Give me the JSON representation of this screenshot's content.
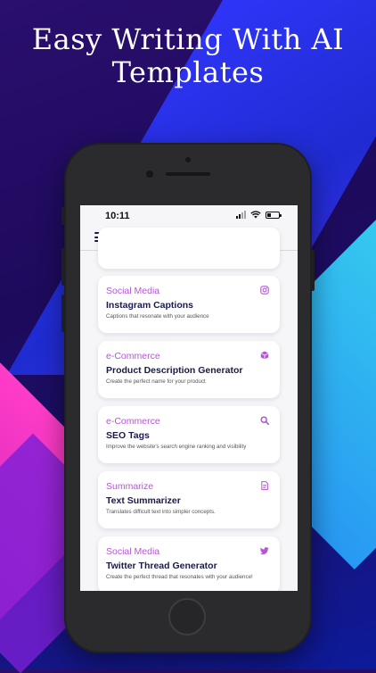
{
  "headline": {
    "line1": "Easy Writing With AI",
    "line2": "Templates"
  },
  "status_bar": {
    "time": "10:11",
    "battery_level": 0.35
  },
  "colors": {
    "category": "#b455d6",
    "title": "#1a1a4a"
  },
  "cards": [
    {
      "category": "Social Media",
      "title": "Instagram Captions",
      "description": "Captions that resonate with your audience",
      "icon": "instagram-icon"
    },
    {
      "category": "e-Commerce",
      "title": "Product Description Generator",
      "description": "Create the perfect name for your product",
      "icon": "box-icon"
    },
    {
      "category": "e-Commerce",
      "title": "SEO Tags",
      "description": "Improve the website's search engine ranking and visibility",
      "icon": "search-icon"
    },
    {
      "category": "Summarize",
      "title": "Text Summarizer",
      "description": "Translates difficult text into simpler concepts.",
      "icon": "document-icon"
    },
    {
      "category": "Social Media",
      "title": "Twitter Thread Generator",
      "description": "Create the perfect thread that resonates with your audience!",
      "icon": "twitter-icon"
    }
  ]
}
